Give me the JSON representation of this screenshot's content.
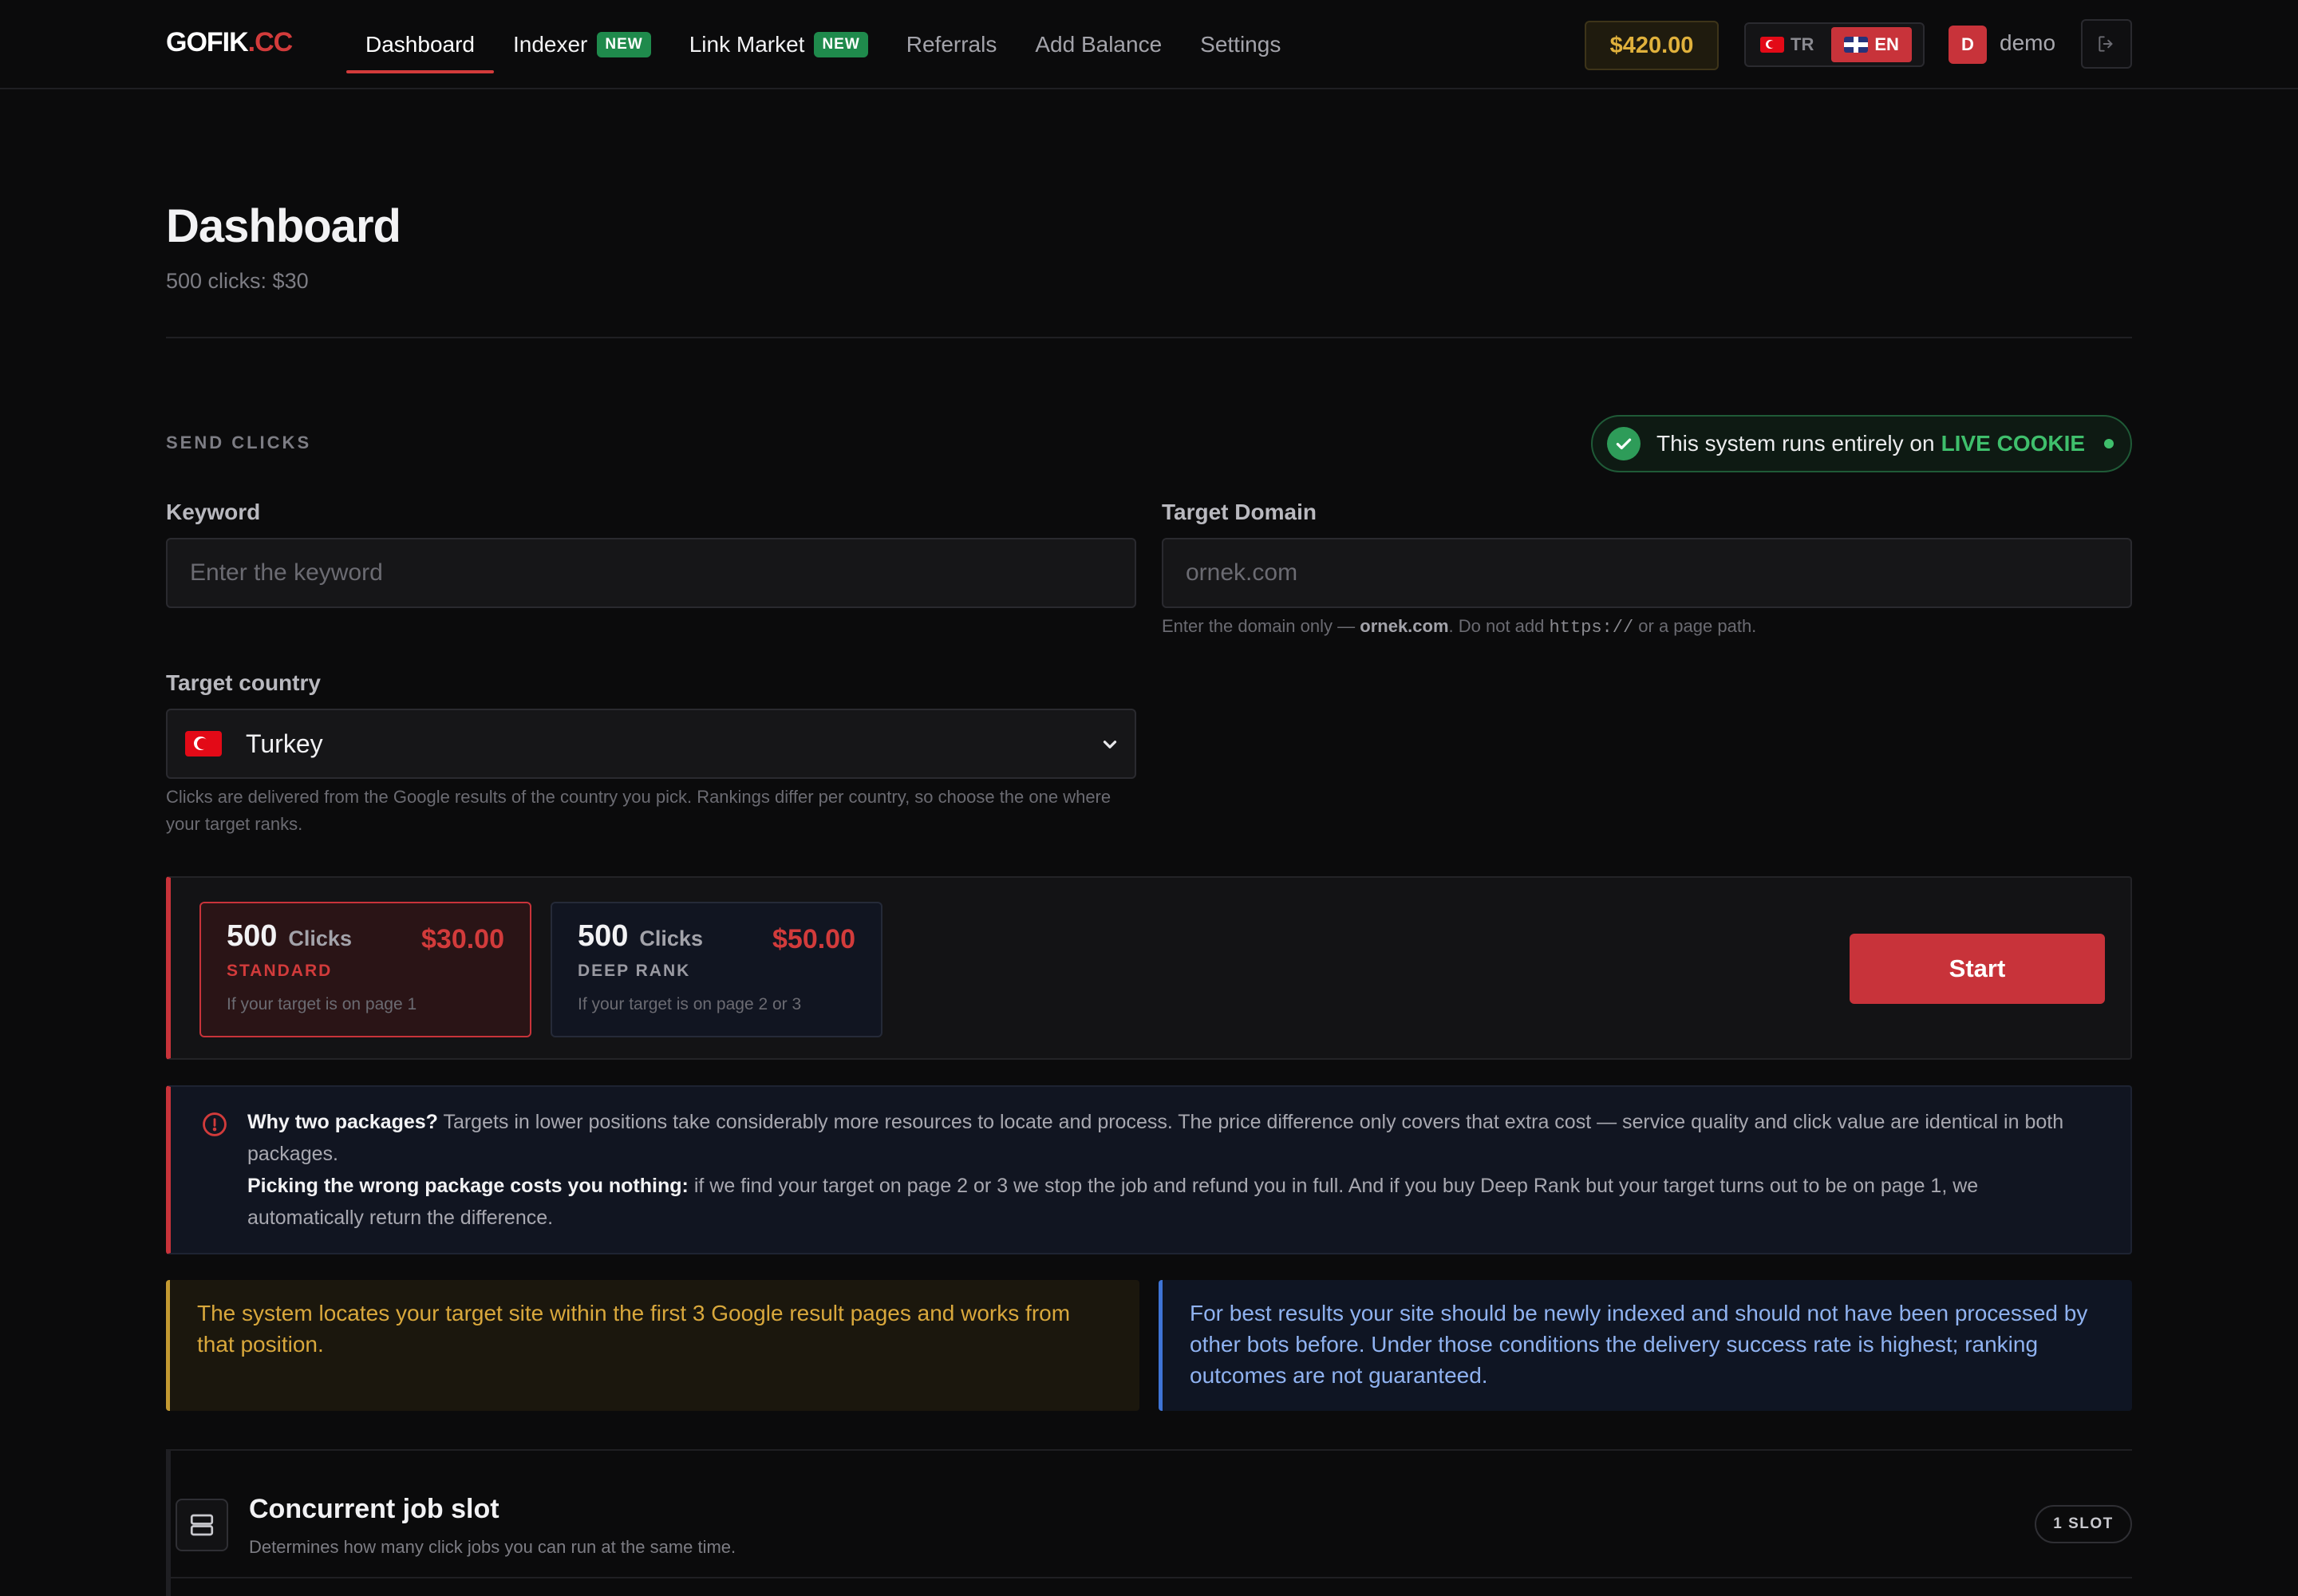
{
  "brand": {
    "name": "GOFIK",
    "suffix": ".CC"
  },
  "nav": {
    "items": [
      {
        "label": "Dashboard",
        "active": true
      },
      {
        "label": "Indexer",
        "badge": "NEW"
      },
      {
        "label": "Link Market",
        "badge": "NEW"
      },
      {
        "label": "Referrals"
      },
      {
        "label": "Add Balance"
      },
      {
        "label": "Settings"
      }
    ]
  },
  "header": {
    "balance": "$420.00",
    "lang": {
      "tr": "TR",
      "en": "EN",
      "active": "EN"
    },
    "user": {
      "initial": "D",
      "name": "demo"
    }
  },
  "page": {
    "title": "Dashboard",
    "subtitle": "500 clicks: $30"
  },
  "send": {
    "section_label": "SEND CLICKS",
    "live": {
      "prefix": "This system runs entirely on",
      "highlight": "LIVE COOKIE"
    },
    "keyword": {
      "label": "Keyword",
      "placeholder": "Enter the keyword",
      "value": ""
    },
    "domain": {
      "label": "Target Domain",
      "placeholder": "ornek.com",
      "value": "",
      "hint_prefix": "Enter the domain only —",
      "hint_example": "ornek.com",
      "hint_mid": ". Do not add",
      "hint_code": "https://",
      "hint_suffix": "or a page path."
    },
    "country": {
      "label": "Target country",
      "value": "Turkey",
      "hint": "Clicks are delivered from the Google results of the country you pick. Rankings differ per country, so choose the one where your target ranks."
    }
  },
  "packages": [
    {
      "count": "500",
      "unit": "Clicks",
      "price": "$30.00",
      "tier": "STANDARD",
      "desc": "If your target is on page 1",
      "selected": true
    },
    {
      "count": "500",
      "unit": "Clicks",
      "price": "$50.00",
      "tier": "DEEP RANK",
      "desc": "If your target is on page 2 or 3",
      "selected": false
    }
  ],
  "start_label": "Start",
  "why": {
    "title": "Why two packages?",
    "body": "Targets in lower positions take considerably more resources to locate and process. The price difference only covers that extra cost — service quality and click value are identical in both packages.",
    "title2": "Picking the wrong package costs you nothing:",
    "body2": "if we find your target on page 2 or 3 we stop the job and refund you in full. And if you buy Deep Rank but your target turns out to be on page 1, we automatically return the difference."
  },
  "notes": {
    "amber": "The system locates your target site within the first 3 Google result pages and works from that position.",
    "blue": "For best results your site should be newly indexed and should not have been processed by other bots before. Under those conditions the delivery success rate is highest; ranking outcomes are not guaranteed."
  },
  "slot": {
    "title": "Concurrent job slot",
    "desc": "Determines how many click jobs you can run at the same time.",
    "badge": "1 SLOT"
  },
  "icons": {
    "logout": "logout-icon",
    "check": "check-icon",
    "info": "info-icon",
    "server": "server-icon",
    "chevron": "chevron-down-icon"
  },
  "colors": {
    "accent": "#c8333a",
    "success": "#3fbf6c",
    "warning": "#d9a83c",
    "info": "#8fb2f0",
    "balance": "#e0b13c"
  }
}
